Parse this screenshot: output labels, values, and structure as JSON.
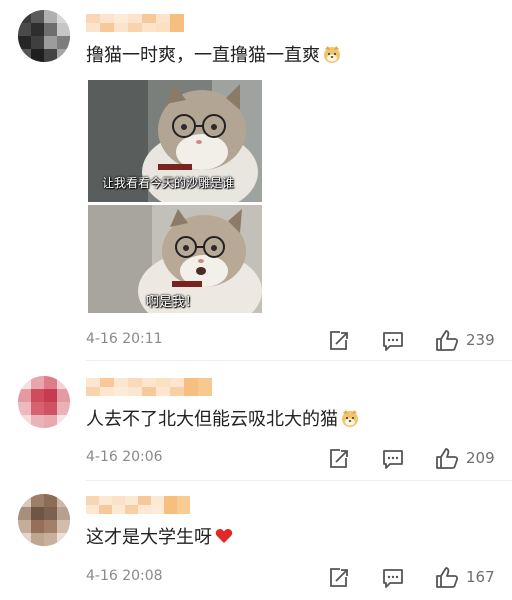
{
  "comments": [
    {
      "text": "撸猫一时爽，一直撸猫一直爽",
      "emoji": "doge-emoji",
      "image_captions": [
        "让我看看今天的沙雕是谁",
        "啊是我！"
      ],
      "timestamp": "4-16 20:11",
      "likes": "239"
    },
    {
      "text": "人去不了北大但能云吸北大的猫",
      "emoji": "doge-emoji",
      "timestamp": "4-16 20:06",
      "likes": "209"
    },
    {
      "text": "这才是大学生呀",
      "emoji": "heart-emoji",
      "timestamp": "4-16 20:08",
      "likes": "167"
    }
  ],
  "colors": {
    "username_pixelated": "#f6c89a",
    "timestamp": "#8a8a8a",
    "icon": "#555555",
    "heart": "#e0292b"
  }
}
